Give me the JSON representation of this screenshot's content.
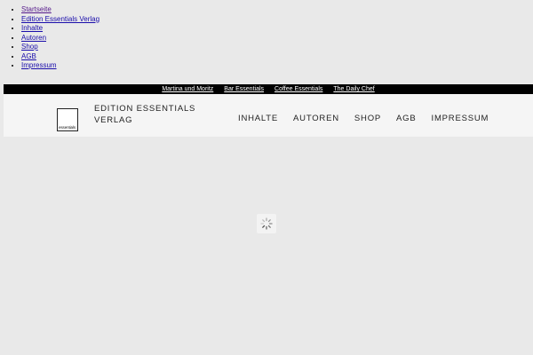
{
  "skip_nav": [
    {
      "label": "Startseite",
      "visited": true
    },
    {
      "label": "Edition Essentials Verlag",
      "visited": false
    },
    {
      "label": "Inhalte",
      "visited": false
    },
    {
      "label": "Autoren",
      "visited": false
    },
    {
      "label": "Shop",
      "visited": false
    },
    {
      "label": "AGB",
      "visited": false
    },
    {
      "label": "Impressum",
      "visited": false
    }
  ],
  "topbar": {
    "links": [
      "Martina und Moritz",
      "Bar Essentials",
      "Coffee Essentials",
      "The Daily Chef"
    ]
  },
  "header": {
    "logo_text": "essentials",
    "brand_line1": "EDITION ESSENTIALS",
    "brand_line2": "VERLAG",
    "nav": [
      "INHALTE",
      "AUTOREN",
      "SHOP",
      "AGB",
      "IMPRESSUM"
    ]
  },
  "loader": {
    "icon": "spinner-icon"
  },
  "colors": {
    "page_bg": "#e9e9e9",
    "header_bg": "#f5f5f5",
    "topbar_bg": "#000000",
    "link": "#1a0dab",
    "visited_link": "#551a8b"
  }
}
